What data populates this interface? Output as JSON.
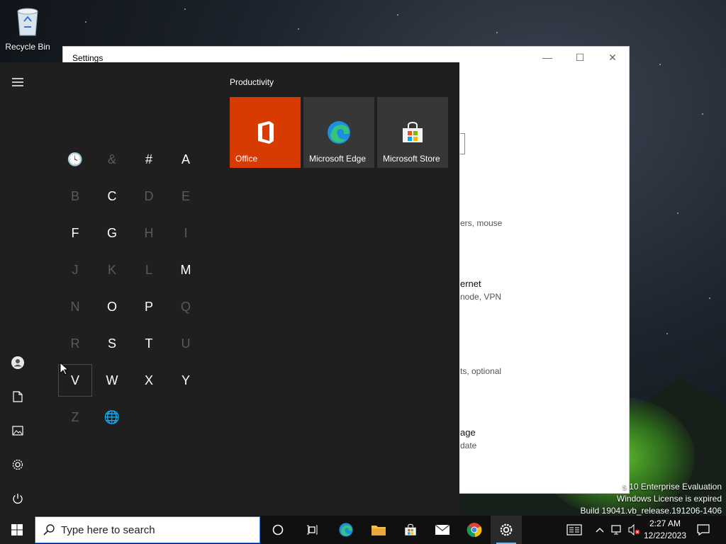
{
  "desktop": {
    "recycle_bin_label": "Recycle Bin",
    "watermark": {
      "line1": "s 10 Enterprise Evaluation",
      "line2": "Windows License is expired",
      "line3": "Build 19041.vb_release.191206-1406"
    }
  },
  "settings_window": {
    "title": "Settings",
    "controls": {
      "minimize": "—",
      "maximize": "☐",
      "close": "✕"
    },
    "visible_text": [
      "ers, mouse",
      "ernet",
      "node, VPN",
      "ts, optional",
      "age",
      "date"
    ]
  },
  "start_menu": {
    "rail": [
      "menu-icon",
      "user-icon",
      "documents-icon",
      "pictures-icon",
      "settings-icon",
      "power-icon"
    ],
    "letters": [
      {
        "char": "🕓",
        "enabled": true
      },
      {
        "char": "&",
        "enabled": false
      },
      {
        "char": "#",
        "enabled": true
      },
      {
        "char": "A",
        "enabled": true
      },
      {
        "char": "B",
        "enabled": false
      },
      {
        "char": "C",
        "enabled": true
      },
      {
        "char": "D",
        "enabled": false
      },
      {
        "char": "E",
        "enabled": false
      },
      {
        "char": "F",
        "enabled": true
      },
      {
        "char": "G",
        "enabled": true
      },
      {
        "char": "H",
        "enabled": false
      },
      {
        "char": "I",
        "enabled": false
      },
      {
        "char": "J",
        "enabled": false
      },
      {
        "char": "K",
        "enabled": false
      },
      {
        "char": "L",
        "enabled": false
      },
      {
        "char": "M",
        "enabled": true
      },
      {
        "char": "N",
        "enabled": false
      },
      {
        "char": "O",
        "enabled": true
      },
      {
        "char": "P",
        "enabled": true
      },
      {
        "char": "Q",
        "enabled": false
      },
      {
        "char": "R",
        "enabled": false
      },
      {
        "char": "S",
        "enabled": true
      },
      {
        "char": "T",
        "enabled": true
      },
      {
        "char": "U",
        "enabled": false
      },
      {
        "char": "V",
        "enabled": true
      },
      {
        "char": "W",
        "enabled": true
      },
      {
        "char": "X",
        "enabled": true
      },
      {
        "char": "Y",
        "enabled": true
      },
      {
        "char": "Z",
        "enabled": false
      },
      {
        "char": "🌐",
        "enabled": false
      }
    ],
    "group_title": "Productivity",
    "tiles": [
      {
        "label": "Office",
        "icon": "office-icon",
        "color": "#d83b01"
      },
      {
        "label": "Microsoft Edge",
        "icon": "edge-icon",
        "color": "#373737"
      },
      {
        "label": "Microsoft Store",
        "icon": "store-icon",
        "color": "#373737"
      }
    ]
  },
  "taskbar": {
    "search_placeholder": "Type here to search",
    "apps": [
      "cortana-icon",
      "task-view-icon",
      "edge-icon",
      "file-explorer-icon",
      "store-icon",
      "mail-icon",
      "chrome-icon",
      "settings-icon"
    ],
    "active_app": "settings-icon",
    "tray": [
      "news-icon",
      "chevron-up-icon",
      "network-icon",
      "volume-muted-icon"
    ],
    "clock": {
      "time": "2:27 AM",
      "date": "12/22/2023"
    },
    "notification_icon": "action-center-icon"
  }
}
